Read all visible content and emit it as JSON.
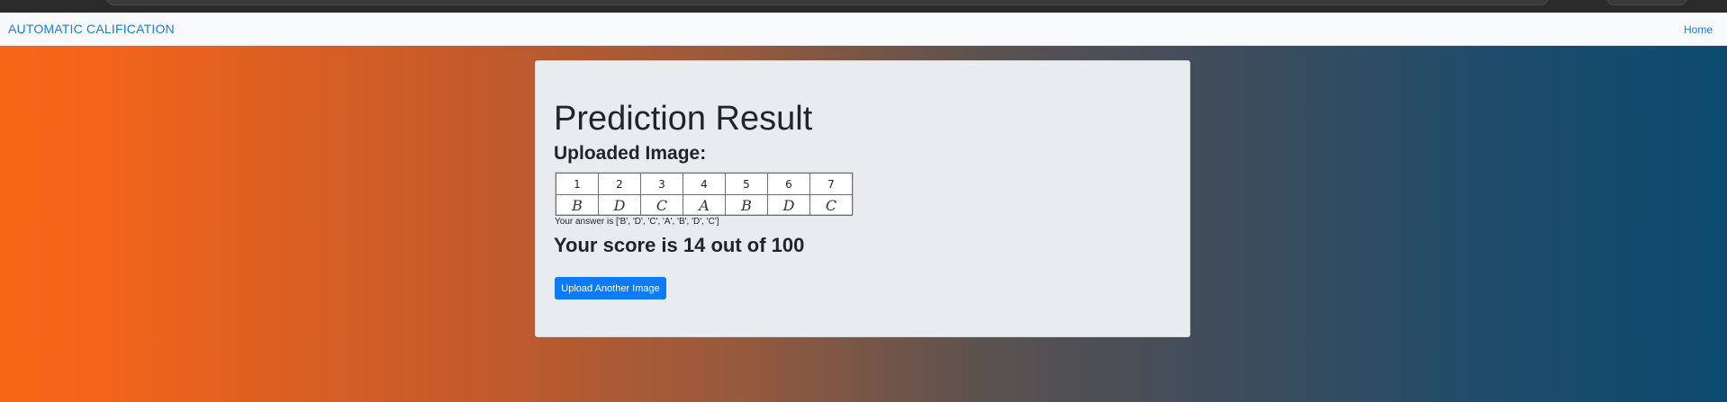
{
  "navbar": {
    "brand": "AUTOMATIC CALIFICATION",
    "home_link": "Home"
  },
  "result": {
    "title": "Prediction Result",
    "uploaded_label": "Uploaded Image:",
    "answer_sheet": {
      "question_numbers": [
        "1",
        "2",
        "3",
        "4",
        "5",
        "6",
        "7"
      ],
      "answers": [
        "B",
        "D",
        "C",
        "A",
        "B",
        "D",
        "C"
      ]
    },
    "answer_text": "Your answer is ['B', 'D', 'C', 'A', 'B', 'D', 'C']",
    "score_text": "Your score is 14 out of 100",
    "upload_button": "Upload Another Image"
  },
  "colors": {
    "brand_link": "#1a7fd8",
    "button": "#0d7bf7",
    "card_bg": "#e9ecef",
    "gradient_left": "#f76616",
    "gradient_right": "#0b4a6f"
  }
}
